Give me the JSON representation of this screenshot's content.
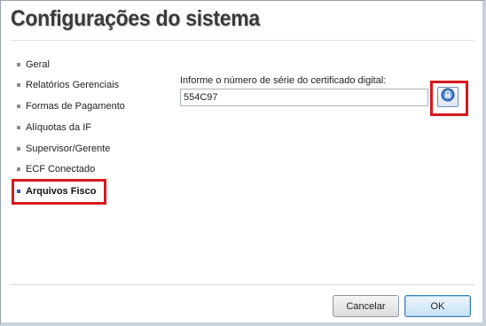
{
  "window": {
    "title": "Configurações do sistema"
  },
  "sidebar": {
    "items": [
      {
        "label": "Geral",
        "active": false
      },
      {
        "label": "Relatórios Gerenciais",
        "active": false
      },
      {
        "label": "Formas de Pagamento",
        "active": false
      },
      {
        "label": "Alíquotas da IF",
        "active": false
      },
      {
        "label": "Supervisor/Gerente",
        "active": false
      },
      {
        "label": "ECF Conectado",
        "active": false
      },
      {
        "label": "Arquivos Fisco",
        "active": true
      }
    ]
  },
  "main": {
    "serial_label": "Informe o número de série do certificado digital:",
    "serial_value": "554C97",
    "cert_button_icon": "certificate-lock-icon"
  },
  "footer": {
    "cancel_label": "Cancelar",
    "ok_label": "OK"
  },
  "colors": {
    "highlight": "#d7191e",
    "active_bullet": "#1f57c3",
    "inactive_bullet": "#8c8c8c"
  }
}
